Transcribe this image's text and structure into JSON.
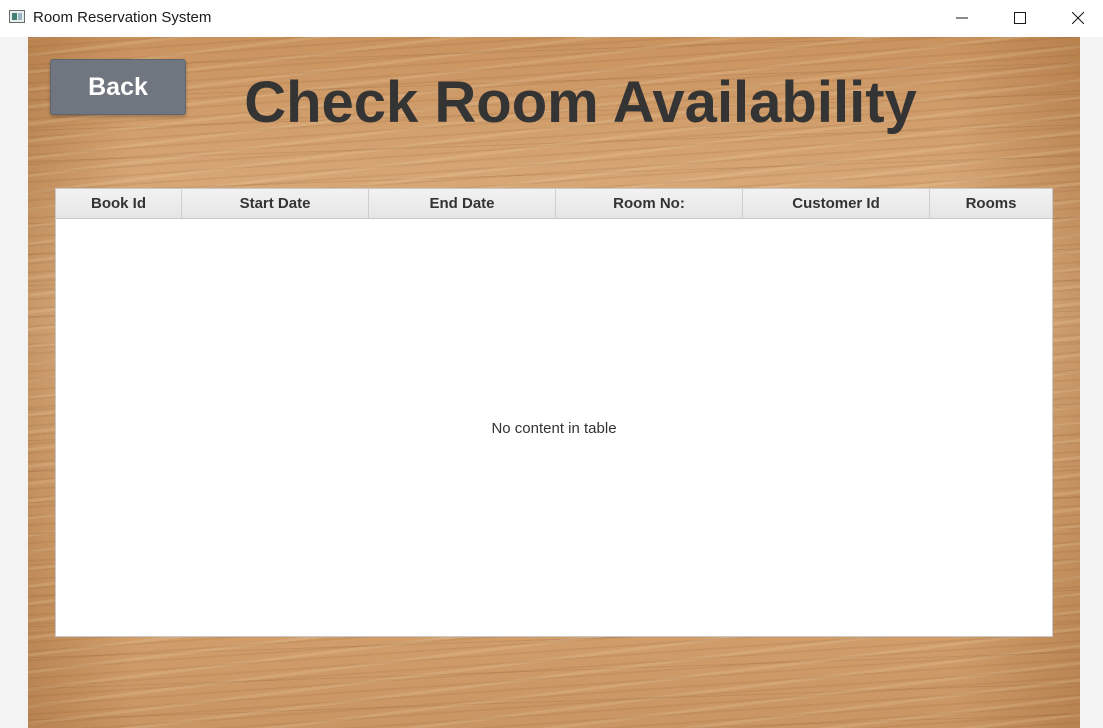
{
  "window": {
    "title": "Room Reservation System"
  },
  "back_button": {
    "label": "Back"
  },
  "page": {
    "title": "Check Room Availability"
  },
  "table": {
    "columns": [
      "Book Id",
      "Start Date",
      "End Date",
      "Room No:",
      "Customer Id",
      "Rooms"
    ],
    "rows": [],
    "placeholder": "No content in table"
  },
  "icons": {
    "app": "app-icon",
    "minimize": "minimize-icon",
    "maximize": "maximize-icon",
    "close": "close-icon"
  },
  "colors": {
    "button_background": "#6f7680",
    "title_text": "#343434",
    "header_background": "#e6e6e6"
  }
}
